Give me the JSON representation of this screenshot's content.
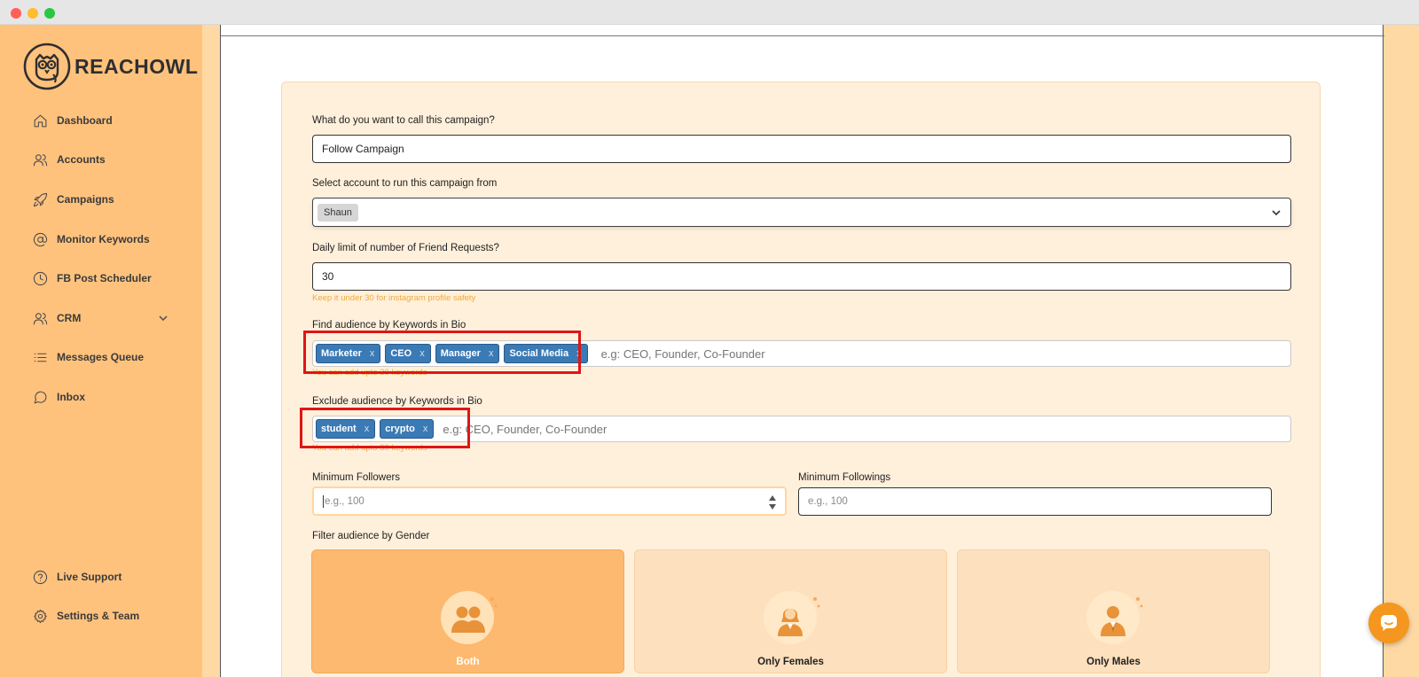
{
  "brand": {
    "name": "REACHOWL"
  },
  "sidebar": {
    "items": [
      {
        "label": "Dashboard",
        "icon": "home-icon"
      },
      {
        "label": "Accounts",
        "icon": "users-icon"
      },
      {
        "label": "Campaigns",
        "icon": "rocket-icon"
      },
      {
        "label": "Monitor Keywords",
        "icon": "at-sign-icon"
      },
      {
        "label": "FB Post Scheduler",
        "icon": "clock-icon"
      },
      {
        "label": "CRM",
        "icon": "users-icon",
        "has_submenu": true
      },
      {
        "label": "Messages Queue",
        "icon": "list-icon"
      },
      {
        "label": "Inbox",
        "icon": "chat-bubble-icon"
      }
    ],
    "bottom_items": [
      {
        "label": "Live Support",
        "icon": "help-circle-icon"
      },
      {
        "label": "Settings & Team",
        "icon": "gear-icon"
      }
    ]
  },
  "form": {
    "campaign_name": {
      "label": "What do you want to call this campaign?",
      "value": "Follow Campaign"
    },
    "account": {
      "label": "Select account to run this campaign from",
      "selected": "Shaun"
    },
    "daily_limit": {
      "label": "Daily limit of number of Friend Requests?",
      "value": "30",
      "hint": "Keep it under 30 for instagram profile safety"
    },
    "include_keywords": {
      "label": "Find audience by Keywords in Bio",
      "tags": [
        "Marketer",
        "CEO",
        "Manager",
        "Social Media"
      ],
      "placeholder": "e.g: CEO, Founder, Co-Founder",
      "hint": "You can add upto 30 keywords"
    },
    "exclude_keywords": {
      "label": "Exclude audience by Keywords in Bio",
      "tags": [
        "student",
        "crypto"
      ],
      "placeholder": "e.g: CEO, Founder, Co-Founder",
      "hint": "You can add upto 30 keywords"
    },
    "min_followers": {
      "label": "Minimum Followers",
      "placeholder": "e.g., 100"
    },
    "min_followings": {
      "label": "Minimum Followings",
      "placeholder": "e.g., 100"
    },
    "gender": {
      "label": "Filter audience by Gender",
      "options": [
        {
          "label": "Both",
          "selected": true
        },
        {
          "label": "Only Females",
          "selected": false
        },
        {
          "label": "Only Males",
          "selected": false
        }
      ]
    }
  },
  "colors": {
    "sidebar_bg": "#ffc27d",
    "card_bg": "#fff0dc",
    "tag_bg": "#3a7ab5",
    "hint_text": "#f0a93a",
    "highlight_box": "#e01515",
    "chat_button": "#f5961e"
  }
}
